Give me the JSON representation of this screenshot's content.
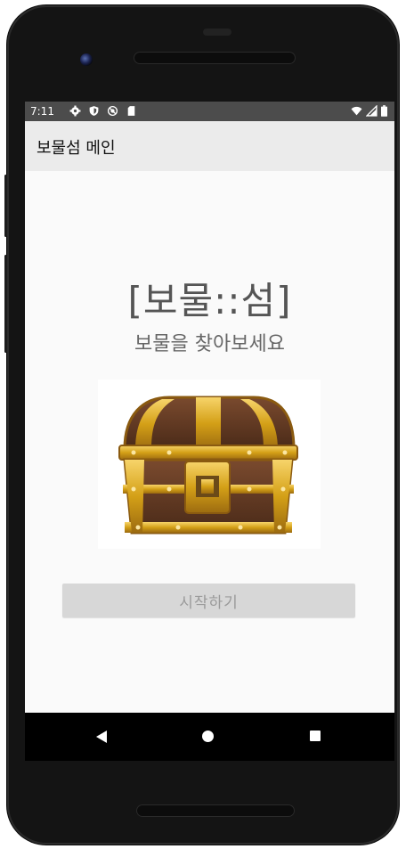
{
  "status_bar": {
    "time": "7:11",
    "left_icons": [
      "settings-gear-icon",
      "shield-icon",
      "location-off-icon",
      "sd-card-icon"
    ],
    "right_icons": [
      "wifi-icon",
      "signal-icon",
      "battery-icon"
    ]
  },
  "app_bar": {
    "title": "보물섬 메인"
  },
  "main": {
    "headline": "[보물::섬]",
    "subheadline": "보물을 찾아보세요",
    "image_icon": "treasure-chest-icon",
    "start_button_label": "시작하기"
  },
  "nav_bar": {
    "icons": [
      "back-icon",
      "home-icon",
      "recents-icon"
    ]
  },
  "colors": {
    "status_bar": "#4c4c4c",
    "app_bar": "#ebebeb",
    "screen_bg": "#fafafa",
    "button_bg": "#d7d7d7",
    "button_text": "#9a9a9a",
    "chest_gold": "#d4a017",
    "chest_wood": "#5a3420"
  }
}
